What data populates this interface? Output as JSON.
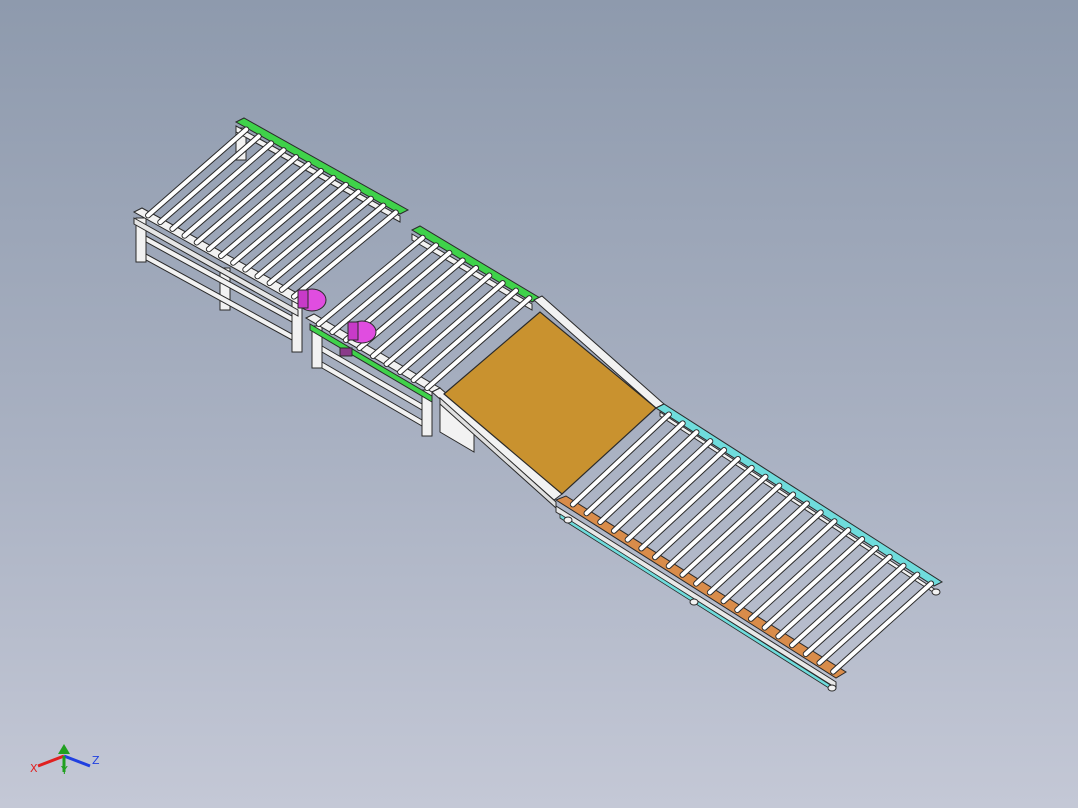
{
  "viewport": {
    "background_top": "#8e9aad",
    "background_bottom": "#c4c8d6"
  },
  "model": {
    "name": "roller-conveyor-assembly",
    "colors": {
      "frame": "#f2f2f2",
      "outline": "#2a2a2a",
      "green_rail": "#3fd24a",
      "cyan_rail": "#6fdcdc",
      "orange_rail": "#d98c4a",
      "plate": "#c9922f",
      "motor": "#e04de0"
    }
  },
  "triad": {
    "x_label": "X",
    "y_label": "Y",
    "z_label": "Z",
    "x_color": "#e02020",
    "y_color": "#20a020",
    "z_color": "#2040e0"
  }
}
